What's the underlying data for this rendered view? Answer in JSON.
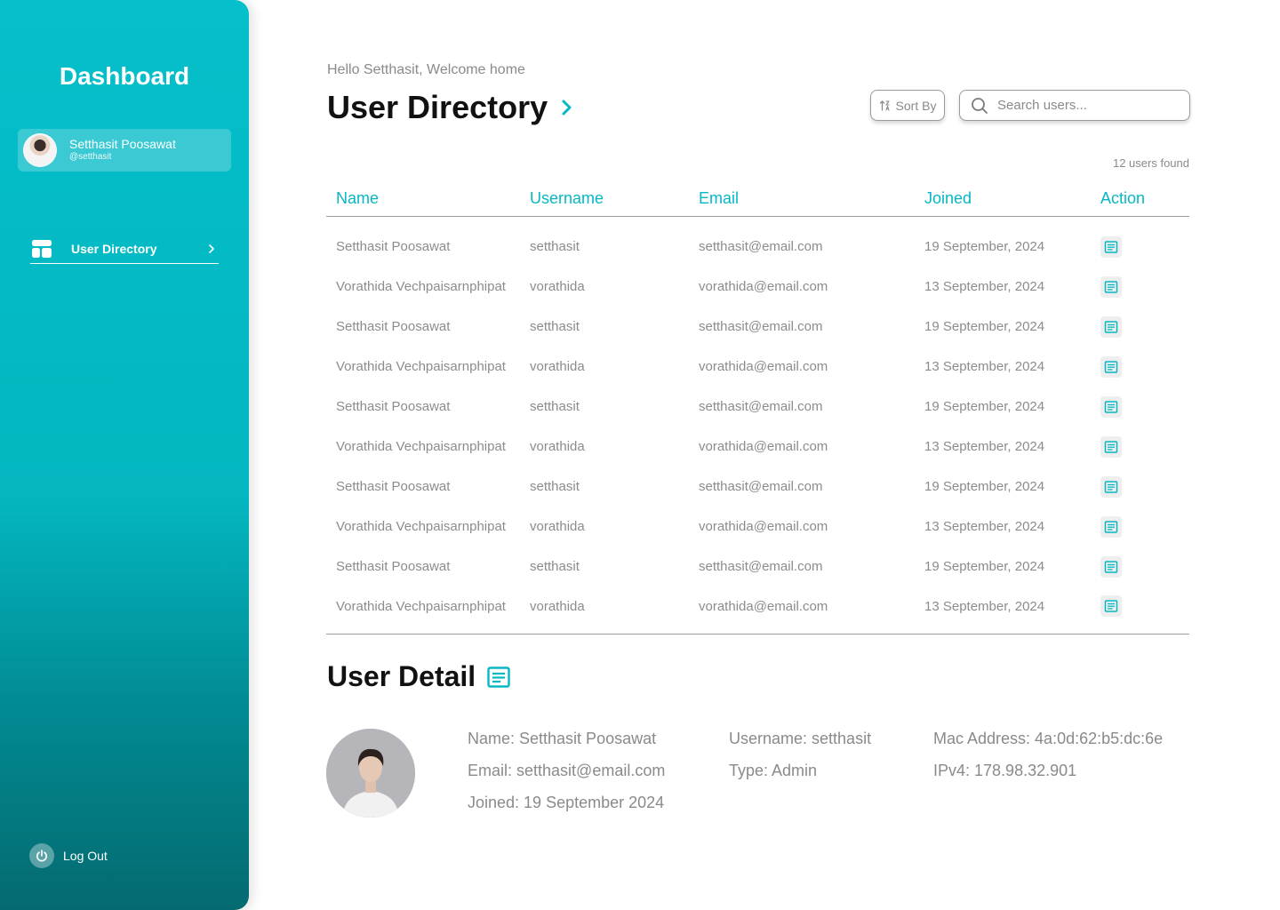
{
  "sidebar": {
    "title": "Dashboard",
    "profile": {
      "name": "Setthasit Poosawat",
      "handle": "@setthasit"
    },
    "nav": [
      {
        "label": "User Directory",
        "icon": "layout-icon",
        "active": true
      }
    ],
    "logout_label": "Log Out"
  },
  "header": {
    "greeting": "Hello Setthasit, Welcome home",
    "title": "User Directory",
    "sort_label": "Sort By",
    "search_placeholder": "Search users...",
    "count_text": "12 users found"
  },
  "table": {
    "columns": [
      "Name",
      "Username",
      "Email",
      "Joined",
      "Action"
    ],
    "rows": [
      {
        "name": "Setthasit Poosawat",
        "username": "setthasit",
        "email": "setthasit@email.com",
        "joined": "19 September, 2024"
      },
      {
        "name": "Vorathida Vechpaisarnphipat",
        "username": "vorathida",
        "email": "vorathida@email.com",
        "joined": "13 September, 2024"
      },
      {
        "name": "Setthasit Poosawat",
        "username": "setthasit",
        "email": "setthasit@email.com",
        "joined": "19 September, 2024"
      },
      {
        "name": "Vorathida Vechpaisarnphipat",
        "username": "vorathida",
        "email": "vorathida@email.com",
        "joined": "13 September, 2024"
      },
      {
        "name": "Setthasit Poosawat",
        "username": "setthasit",
        "email": "setthasit@email.com",
        "joined": "19 September, 2024"
      },
      {
        "name": "Vorathida Vechpaisarnphipat",
        "username": "vorathida",
        "email": "vorathida@email.com",
        "joined": "13 September, 2024"
      },
      {
        "name": "Setthasit Poosawat",
        "username": "setthasit",
        "email": "setthasit@email.com",
        "joined": "19 September, 2024"
      },
      {
        "name": "Vorathida Vechpaisarnphipat",
        "username": "vorathida",
        "email": "vorathida@email.com",
        "joined": "13 September, 2024"
      },
      {
        "name": "Setthasit Poosawat",
        "username": "setthasit",
        "email": "setthasit@email.com",
        "joined": "19 September, 2024"
      },
      {
        "name": "Vorathida Vechpaisarnphipat",
        "username": "vorathida",
        "email": "vorathida@email.com",
        "joined": "13 September, 2024"
      }
    ]
  },
  "detail": {
    "title": "User Detail",
    "name": "Name: Setthasit Poosawat",
    "email": "Email: setthasit@email.com",
    "joined": "Joined: 19 September 2024",
    "username": "Username: setthasit",
    "type": "Type: Admin",
    "mac": "Mac Address: 4a:0d:62:b5:dc:6e",
    "ipv4": "IPv4: 178.98.32.901"
  },
  "colors": {
    "accent": "#06b8c4",
    "sidebar_top": "#05bfca",
    "sidebar_bottom": "#046a70",
    "muted_text": "#8a8a8a"
  }
}
